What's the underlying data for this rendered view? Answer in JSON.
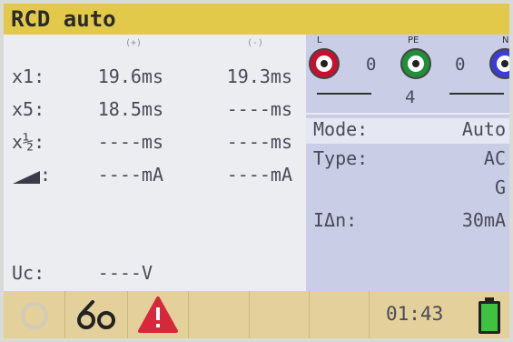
{
  "title": "RCD auto",
  "columns": {
    "pos": "(+)",
    "neg": "(-)"
  },
  "rows": [
    {
      "label": "x1:",
      "pos": "19.6ms",
      "neg": "19.3ms"
    },
    {
      "label": "x5:",
      "pos": "18.5ms",
      "neg": "----ms"
    },
    {
      "label": "x½:",
      "pos": "----ms",
      "neg": "----ms"
    },
    {
      "label": ":",
      "pos": "----mA",
      "neg": "----mA"
    }
  ],
  "uc": {
    "label": "Uc:",
    "value": "----V"
  },
  "terminals": [
    {
      "name": "L",
      "color": "#c8102e"
    },
    {
      "name": "PE",
      "color": "#1f8f3a"
    },
    {
      "name": "N",
      "color": "#3b3bd6"
    }
  ],
  "voltages": {
    "l_pe": "0",
    "pe_n": "0",
    "l_n": "4"
  },
  "settings": [
    {
      "label": "Mode:",
      "value": "Auto"
    },
    {
      "label": "Type:",
      "value": "AC"
    },
    {
      "label": "",
      "value": "G"
    },
    {
      "label": "IΔn:",
      "value": "30mA"
    }
  ],
  "status": {
    "time": "01:43"
  },
  "icons": [
    "busy-spinner-icon",
    "test-leads-icon",
    "warning-icon",
    "battery-icon"
  ],
  "colors": {
    "titlebar": "#e2c94a",
    "warning": "#d6283a",
    "battery": "#3fc23f"
  }
}
